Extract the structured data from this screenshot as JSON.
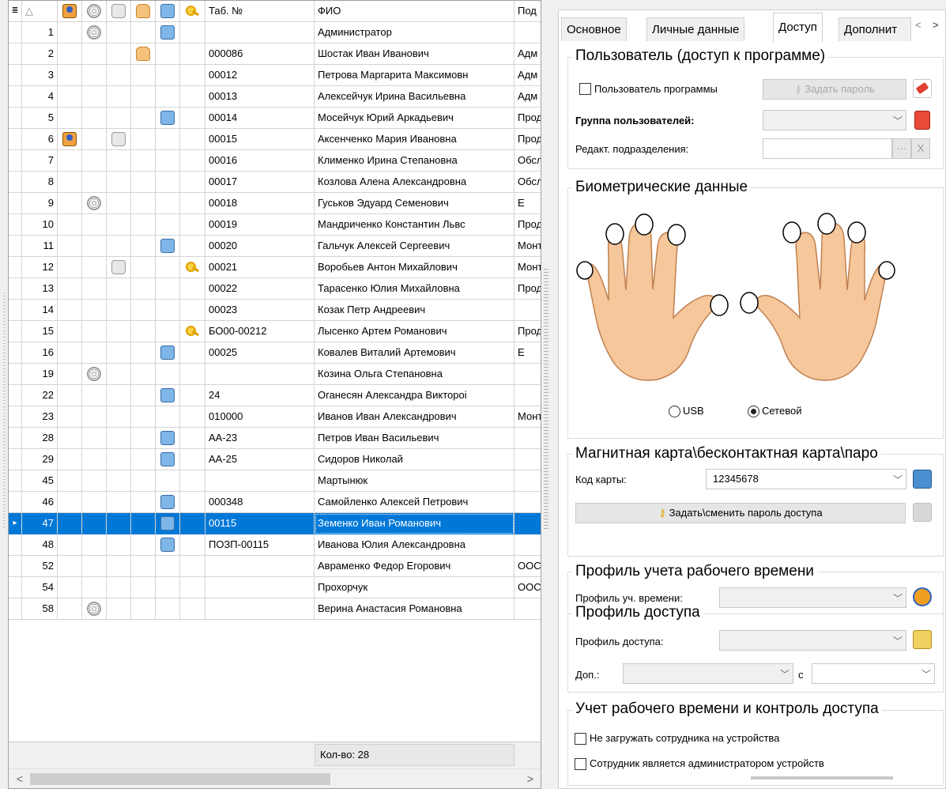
{
  "grid": {
    "header": {
      "indicator": "≣",
      "sort": "△",
      "tab": "Таб. №",
      "fio": "ФИО",
      "pod": "Под"
    },
    "rows": [
      {
        "num": "1",
        "icons": [
          "",
          "finger",
          "",
          "",
          "card",
          ""
        ],
        "tab": "",
        "fio": "Администратор",
        "pod": ""
      },
      {
        "num": "2",
        "icons": [
          "",
          "",
          "",
          "hand",
          "",
          ""
        ],
        "tab": "000086",
        "fio": "Шостак Иван Иванович",
        "pod": "Адм"
      },
      {
        "num": "3",
        "icons": [
          "",
          "",
          "",
          "",
          "",
          ""
        ],
        "tab": "00012",
        "fio": "Петрова Маргарита Максимовн",
        "pod": "Адм"
      },
      {
        "num": "4",
        "icons": [
          "",
          "",
          "",
          "",
          "",
          ""
        ],
        "tab": "00013",
        "fio": "Алексейчук Ирина Васильевна",
        "pod": "Адм"
      },
      {
        "num": "5",
        "icons": [
          "",
          "",
          "",
          "",
          "card",
          ""
        ],
        "tab": "00014",
        "fio": "Мосейчук Юрий Аркадьевич",
        "pod": "Прод"
      },
      {
        "num": "6",
        "icons": [
          "person",
          "",
          "face",
          "",
          "",
          ""
        ],
        "tab": "00015",
        "fio": "Аксенченко Мария Ивановна",
        "pod": "Прод"
      },
      {
        "num": "7",
        "icons": [
          "",
          "",
          "",
          "",
          "",
          ""
        ],
        "tab": "00016",
        "fio": "Клименко Ирина Степановна",
        "pod": "Обсл"
      },
      {
        "num": "8",
        "icons": [
          "",
          "",
          "",
          "",
          "",
          ""
        ],
        "tab": "00017",
        "fio": "Козлова Алена Александровна",
        "pod": "Обсл"
      },
      {
        "num": "9",
        "icons": [
          "",
          "finger",
          "",
          "",
          "",
          ""
        ],
        "tab": "00018",
        "fio": "Гуськов Эдуард Семенович",
        "pod": "Е"
      },
      {
        "num": "10",
        "icons": [
          "",
          "",
          "",
          "",
          "",
          ""
        ],
        "tab": "00019",
        "fio": "Мандриченко Константин Львс",
        "pod": "Прод"
      },
      {
        "num": "11",
        "icons": [
          "",
          "",
          "",
          "",
          "card",
          ""
        ],
        "tab": "00020",
        "fio": "Гальчук Алексей Сергеевич",
        "pod": "Монт"
      },
      {
        "num": "12",
        "icons": [
          "",
          "",
          "face",
          "",
          "",
          "key"
        ],
        "tab": "00021",
        "fio": "Воробьев Антон Михайлович",
        "pod": "Монт"
      },
      {
        "num": "13",
        "icons": [
          "",
          "",
          "",
          "",
          "",
          ""
        ],
        "tab": "00022",
        "fio": "Тарасенко Юлия Михайловна",
        "pod": "Прод"
      },
      {
        "num": "14",
        "icons": [
          "",
          "",
          "",
          "",
          "",
          ""
        ],
        "tab": "00023",
        "fio": "Козак Петр Андреевич",
        "pod": ""
      },
      {
        "num": "15",
        "icons": [
          "",
          "",
          "",
          "",
          "",
          "key"
        ],
        "tab": "БО00-00212",
        "fio": "Лысенко Артем Романович",
        "pod": "Прод"
      },
      {
        "num": "16",
        "icons": [
          "",
          "",
          "",
          "",
          "card",
          ""
        ],
        "tab": "00025",
        "fio": "Ковалев Виталий Артемович",
        "pod": "Е"
      },
      {
        "num": "19",
        "icons": [
          "",
          "finger",
          "",
          "",
          "",
          ""
        ],
        "tab": "",
        "fio": "Козина Ольга Степановна",
        "pod": ""
      },
      {
        "num": "22",
        "icons": [
          "",
          "",
          "",
          "",
          "card",
          ""
        ],
        "tab": "24",
        "fio": "Оганесян Александра Виктороі",
        "pod": ""
      },
      {
        "num": "23",
        "icons": [
          "",
          "",
          "",
          "",
          "",
          ""
        ],
        "tab": "010000",
        "fio": "Иванов Иван Александрович",
        "pod": "Монт"
      },
      {
        "num": "28",
        "icons": [
          "",
          "",
          "",
          "",
          "card",
          ""
        ],
        "tab": "АА-23",
        "fio": "Петров Иван Васильевич",
        "pod": ""
      },
      {
        "num": "29",
        "icons": [
          "",
          "",
          "",
          "",
          "card",
          ""
        ],
        "tab": "АА-25",
        "fio": "Сидоров Николай",
        "pod": ""
      },
      {
        "num": "45",
        "icons": [
          "",
          "",
          "",
          "",
          "",
          ""
        ],
        "tab": "",
        "fio": "Мартынюк",
        "pod": ""
      },
      {
        "num": "46",
        "icons": [
          "",
          "",
          "",
          "",
          "card",
          ""
        ],
        "tab": "000348",
        "fio": "Самойленко Алексей Петрович",
        "pod": ""
      },
      {
        "num": "47",
        "icons": [
          "",
          "",
          "",
          "",
          "card",
          ""
        ],
        "tab": "00115",
        "fio": "Земенко Иван Романович",
        "pod": "",
        "selected": true
      },
      {
        "num": "48",
        "icons": [
          "",
          "",
          "",
          "",
          "card",
          ""
        ],
        "tab": "ПОЗП-00115",
        "fio": "Иванова Юлия Александровна",
        "pod": ""
      },
      {
        "num": "52",
        "icons": [
          "",
          "",
          "",
          "",
          "",
          ""
        ],
        "tab": "",
        "fio": "Авраменко Федор Егорович",
        "pod": "ООС"
      },
      {
        "num": "54",
        "icons": [
          "",
          "",
          "",
          "",
          "",
          ""
        ],
        "tab": "",
        "fio": "Прохорчук",
        "pod": "ООС"
      },
      {
        "num": "58",
        "icons": [
          "",
          "finger",
          "",
          "",
          "",
          ""
        ],
        "tab": "",
        "fio": "Верина Анастасия Романовна",
        "pod": ""
      }
    ],
    "footer_count": "Кол-во: 28",
    "scroll_left": "<",
    "scroll_right": ">"
  },
  "tabs": {
    "items": [
      "Основное",
      "Личные данные",
      "Доступ",
      "Дополнит"
    ],
    "active": "Доступ",
    "prev": "<",
    "next": ">"
  },
  "user_access": {
    "title": "Пользователь (доступ к программе)",
    "program_user_label": "Пользователь программы",
    "program_user_checked": false,
    "set_password_button": "Задать пароль",
    "group_label": "Группа пользователей:",
    "group_value": "",
    "edit_dept_label": "Редакт. подразделения:",
    "edit_dept_value": "",
    "ellipsis": "···",
    "clear": "X"
  },
  "biometric": {
    "title": "Биометрические данные",
    "radio_usb": "USB",
    "radio_network": "Сетевой",
    "selected": "Сетевой"
  },
  "card": {
    "title": "Магнитная карта\\бесконтактная карта\\паро",
    "code_label": "Код карты:",
    "code_value": "12345678",
    "set_password_button": "Задать\\сменить пароль доступа"
  },
  "time_profile": {
    "title": "Профиль учета рабочего времени",
    "label": "Профиль уч. времени:",
    "value": ""
  },
  "access_profile": {
    "title": "Профиль доступа",
    "label": "Профиль доступа:",
    "value": "",
    "extra_label": "Доп.:",
    "extra_value": "",
    "from_label": "с",
    "from_value": ""
  },
  "tracking": {
    "title": "Учет рабочего времени и контроль доступа",
    "no_upload_label": "Не загружать сотрудника на устройства",
    "no_upload_checked": false,
    "admin_label": "Сотрудник является администратором устройств",
    "admin_checked": false
  },
  "colors": {
    "selection": "#0078d7",
    "skin": "#f6c79a"
  }
}
